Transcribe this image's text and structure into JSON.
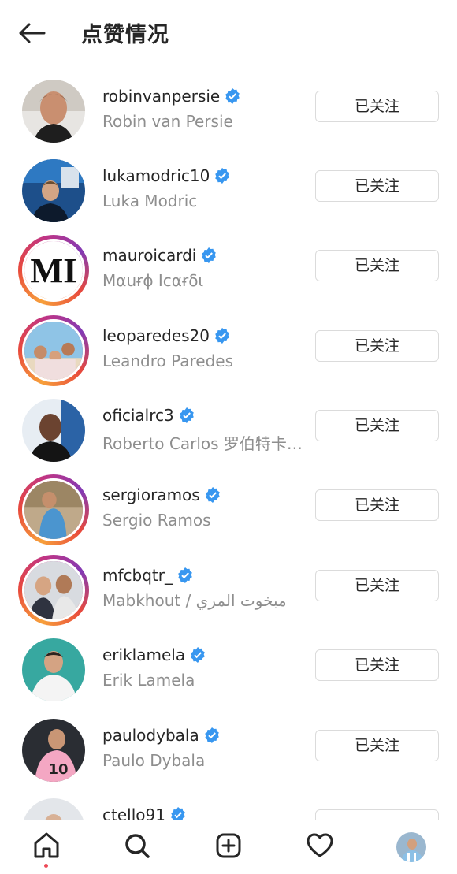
{
  "header": {
    "title": "点赞情况"
  },
  "colors": {
    "verified": "#3897f0",
    "muted": "#8e8e8e",
    "text": "#262626",
    "notification_dot": "#ed4956"
  },
  "rows": [
    {
      "username": "robinvanpersie",
      "fullname": "Robin van Persie",
      "button": "已关注",
      "story": false
    },
    {
      "username": "lukamodric10",
      "fullname": "Luka Modric",
      "button": "已关注",
      "story": false
    },
    {
      "username": "mauroicardi",
      "fullname": "Mαuɍɸ Icαɍδι",
      "button": "已关注",
      "story": true
    },
    {
      "username": "leoparedes20",
      "fullname": "Leandro Paredes",
      "button": "已关注",
      "story": true
    },
    {
      "username": "oficialrc3",
      "fullname": "Roberto Carlos 罗伯特卡洛斯",
      "button": "已关注",
      "story": false
    },
    {
      "username": "sergioramos",
      "fullname": "Sergio Ramos",
      "button": "已关注",
      "story": true
    },
    {
      "username": "mfcbqtr_",
      "fullname": "Mabkhout / مبخوت المري",
      "button": "已关注",
      "story": true
    },
    {
      "username": "eriklamela",
      "fullname": "Erik Lamela",
      "button": "已关注",
      "story": false
    },
    {
      "username": "paulodybala",
      "fullname": "Paulo Dybala",
      "button": "已关注",
      "story": false
    },
    {
      "username": "ctello91",
      "fullname": "",
      "button": "",
      "story": false
    }
  ],
  "nav": {
    "icons": [
      "home-icon",
      "search-icon",
      "new-post-icon",
      "activity-heart-icon",
      "profile-avatar"
    ]
  }
}
